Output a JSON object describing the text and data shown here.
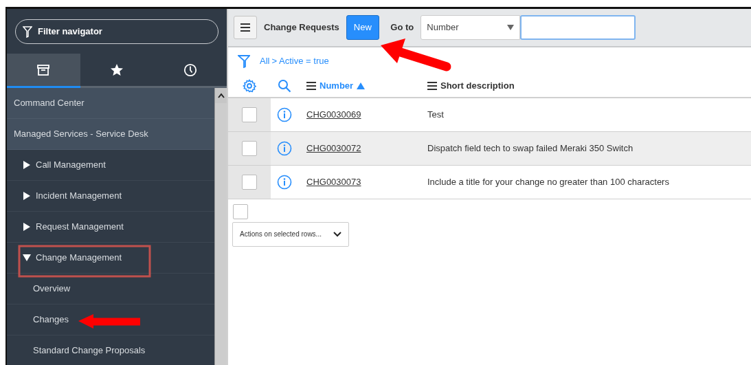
{
  "navigator": {
    "filter_placeholder": "Filter navigator",
    "tabs": [
      {
        "kind": "all",
        "selected": true
      },
      {
        "kind": "favorites",
        "selected": false
      },
      {
        "kind": "history",
        "selected": false
      }
    ],
    "items": [
      {
        "label": "Command Center",
        "kind": "application"
      },
      {
        "label": "Managed Services - Service Desk",
        "kind": "application",
        "children": [
          {
            "label": "Call Management",
            "kind": "module",
            "expanded": false
          },
          {
            "label": "Incident Management",
            "kind": "module",
            "expanded": false
          },
          {
            "label": "Request Management",
            "kind": "module",
            "expanded": false
          },
          {
            "label": "Change Management",
            "kind": "module",
            "expanded": true,
            "children": [
              {
                "label": "Overview",
                "kind": "link"
              },
              {
                "label": "Changes",
                "kind": "link"
              },
              {
                "label": "Standard Change Proposals",
                "kind": "link"
              }
            ]
          }
        ]
      }
    ]
  },
  "list_header": {
    "title": "Change Requests",
    "new_button": "New",
    "goto_label": "Go to",
    "goto_field": "Number"
  },
  "breadcrumb": [
    {
      "label": "All"
    },
    {
      "label": ">"
    },
    {
      "label": "Active = true"
    }
  ],
  "table": {
    "columns": [
      {
        "label": "Number",
        "sort_ascending": true
      },
      {
        "label": "Short description"
      }
    ],
    "rows": [
      {
        "number": "CHG0030069",
        "description": "Test",
        "checked": false,
        "hovered": false
      },
      {
        "number": "CHG0030072",
        "description": "Dispatch field tech to swap failed Meraki 350 Switch",
        "checked": false,
        "hovered": true
      },
      {
        "number": "CHG0030073",
        "description": "Include a title for your change no greater than 100 characters",
        "checked": false,
        "hovered": false
      }
    ],
    "select_all_checked": false,
    "actions_label": "Actions on selected rows..."
  }
}
